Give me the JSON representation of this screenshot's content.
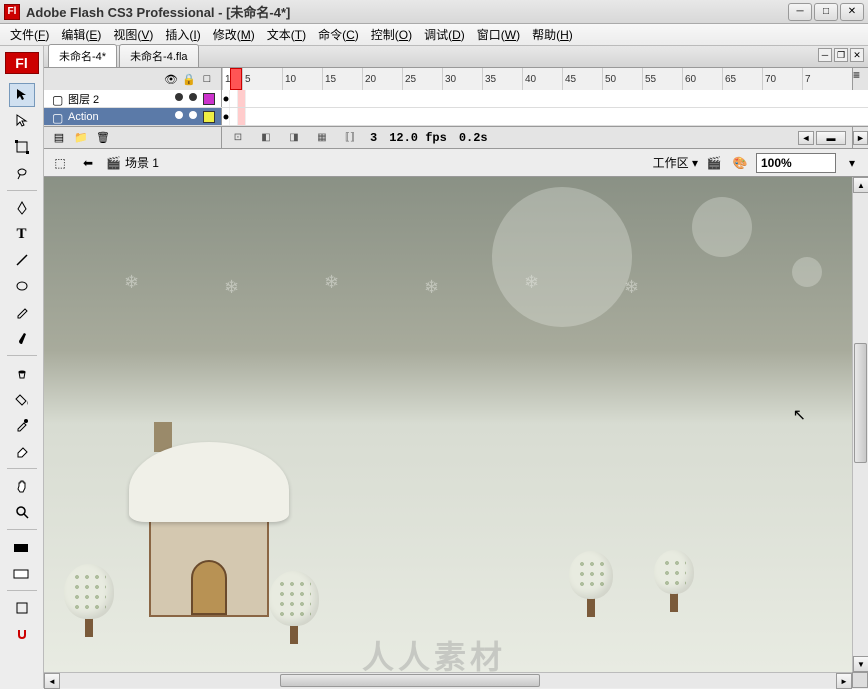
{
  "titlebar": {
    "icon_text": "Fl",
    "title": "Adobe Flash CS3 Professional - [未命名-4*]"
  },
  "menus": [
    {
      "label": "文件",
      "key": "F"
    },
    {
      "label": "编辑",
      "key": "E"
    },
    {
      "label": "视图",
      "key": "V"
    },
    {
      "label": "插入",
      "key": "I"
    },
    {
      "label": "修改",
      "key": "M"
    },
    {
      "label": "文本",
      "key": "T"
    },
    {
      "label": "命令",
      "key": "C"
    },
    {
      "label": "控制",
      "key": "O"
    },
    {
      "label": "调试",
      "key": "D"
    },
    {
      "label": "窗口",
      "key": "W"
    },
    {
      "label": "帮助",
      "key": "H"
    }
  ],
  "tabs": [
    {
      "label": "未命名-4*",
      "active": true
    },
    {
      "label": "未命名-4.fla",
      "active": false
    }
  ],
  "timeline": {
    "ruler": [
      "1",
      "5",
      "10",
      "15",
      "20",
      "25",
      "30",
      "35",
      "40",
      "45",
      "50",
      "55",
      "60",
      "65",
      "70",
      "7"
    ],
    "layers": [
      {
        "name": "图层 2",
        "selected": false,
        "color": "#cc33cc"
      },
      {
        "name": "Action",
        "selected": true,
        "color": "#eeee44"
      }
    ],
    "footer": {
      "frame": "3",
      "fps": "12.0 fps",
      "time": "0.2s"
    }
  },
  "scene": {
    "label": "场景 1",
    "workspace": "工作区 ▾",
    "zoom": "100%"
  },
  "toolbox_header": "Fl",
  "watermark": "人人素材"
}
